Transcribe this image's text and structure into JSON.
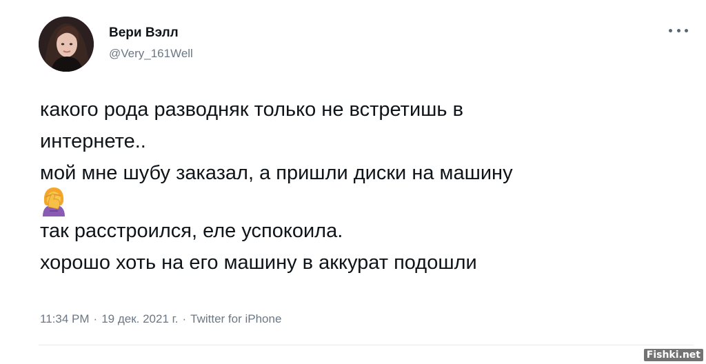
{
  "author": {
    "display_name": "Вери Вэлл",
    "handle": "@Very_161Well",
    "avatar_icon": "user-avatar-photo"
  },
  "menu": {
    "icon": "more-options-icon"
  },
  "tweet": {
    "lines": [
      "какого рода разводняк только не встретишь в",
      "интернете..",
      "мой мне шубу заказал, а пришли диски на машину",
      "так расстроился, еле успокоила.",
      "хорошо хоть на его машину в аккурат подошли"
    ],
    "emoji": "woman-facepalming-emoji"
  },
  "meta": {
    "time": "11:34 PM",
    "date": "19 дек. 2021 г.",
    "separator": "·",
    "source": "Twitter for iPhone"
  },
  "watermark": "Fishki.net",
  "colors": {
    "text": "#0f1419",
    "secondary": "#6b7784",
    "background": "#ffffff"
  }
}
